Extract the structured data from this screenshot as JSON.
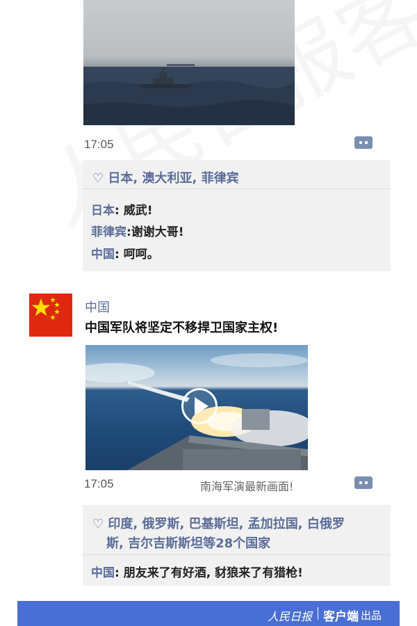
{
  "post_1": {
    "time": "17:05",
    "likes": "日本, 澳大利亚, 菲律宾",
    "comments": [
      {
        "author": "日本",
        "sep": ": ",
        "text": "威武!"
      },
      {
        "author": "菲律宾",
        "sep": ":",
        "text": "谢谢大哥!"
      },
      {
        "author": "中国",
        "sep": ": ",
        "text": "呵呵。"
      }
    ]
  },
  "post_2": {
    "author": "中国",
    "text": "中国军队将坚定不移捍卫国家主权!",
    "time": "17:05",
    "video_caption": "南海军演最新画面!",
    "likes_line1": "印度, 俄罗斯, 巴基斯坦, 孟加拉国, 白俄罗",
    "likes_line2": "斯, 吉尔吉斯斯坦等28个国家",
    "comments": [
      {
        "author": "中国",
        "sep": ": ",
        "text": "朋友来了有好酒, 豺狼来了有猎枪!"
      }
    ]
  },
  "footer": {
    "logo": "人民日报",
    "brand": "客户端",
    "suffix": "出品"
  },
  "watermark": "人民日报客户端",
  "colors": {
    "name_blue": "#5a6c99",
    "footer_bar": "#4a6fd4",
    "flag_red": "#de2910",
    "flag_star": "#ffde00",
    "likes_bg": "#f1f1f1"
  },
  "icons": [
    "heart-outline-icon",
    "comment-icon",
    "play-icon",
    "star-icon"
  ]
}
